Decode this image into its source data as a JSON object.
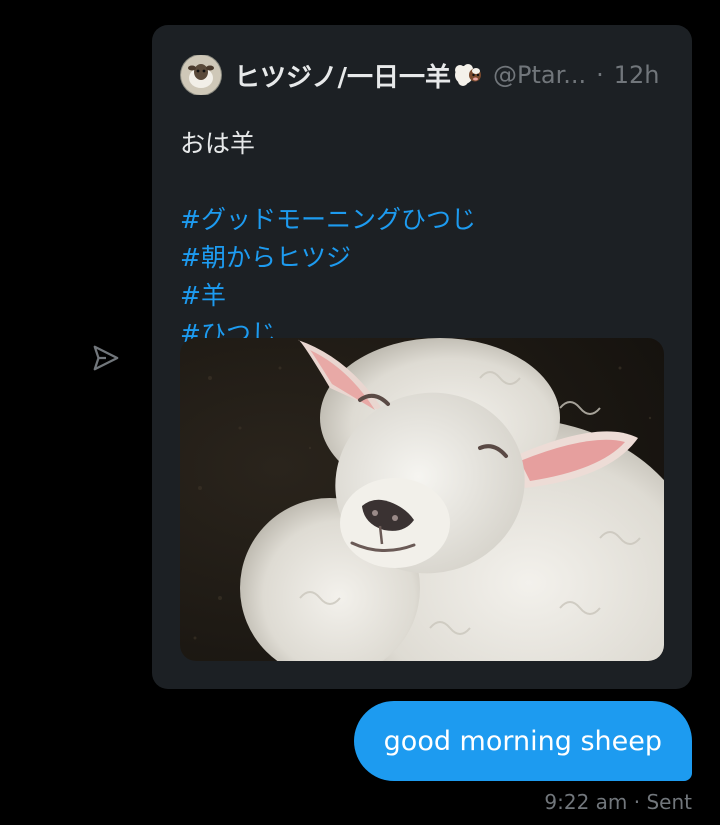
{
  "dm": {
    "share_icon": "send-icon",
    "tweet": {
      "display_name": "ヒツジノ/一日一羊",
      "handle": "@Ptar...",
      "separator": "·",
      "time": "12h",
      "text_lines": [
        "おは羊",
        "",
        "#グッドモーニングひつじ",
        "#朝からヒツジ",
        "#羊",
        "#ひつじ"
      ],
      "image_description_icon": "sheep-photo"
    },
    "message": {
      "text": "good morning sheep",
      "time": "9:22 am",
      "status_separator": "·",
      "status": "Sent"
    }
  },
  "colors": {
    "background": "#000000",
    "card": "#1c2024",
    "accent": "#1d9bf0",
    "muted": "#71767b",
    "text": "#e7e9ea"
  }
}
